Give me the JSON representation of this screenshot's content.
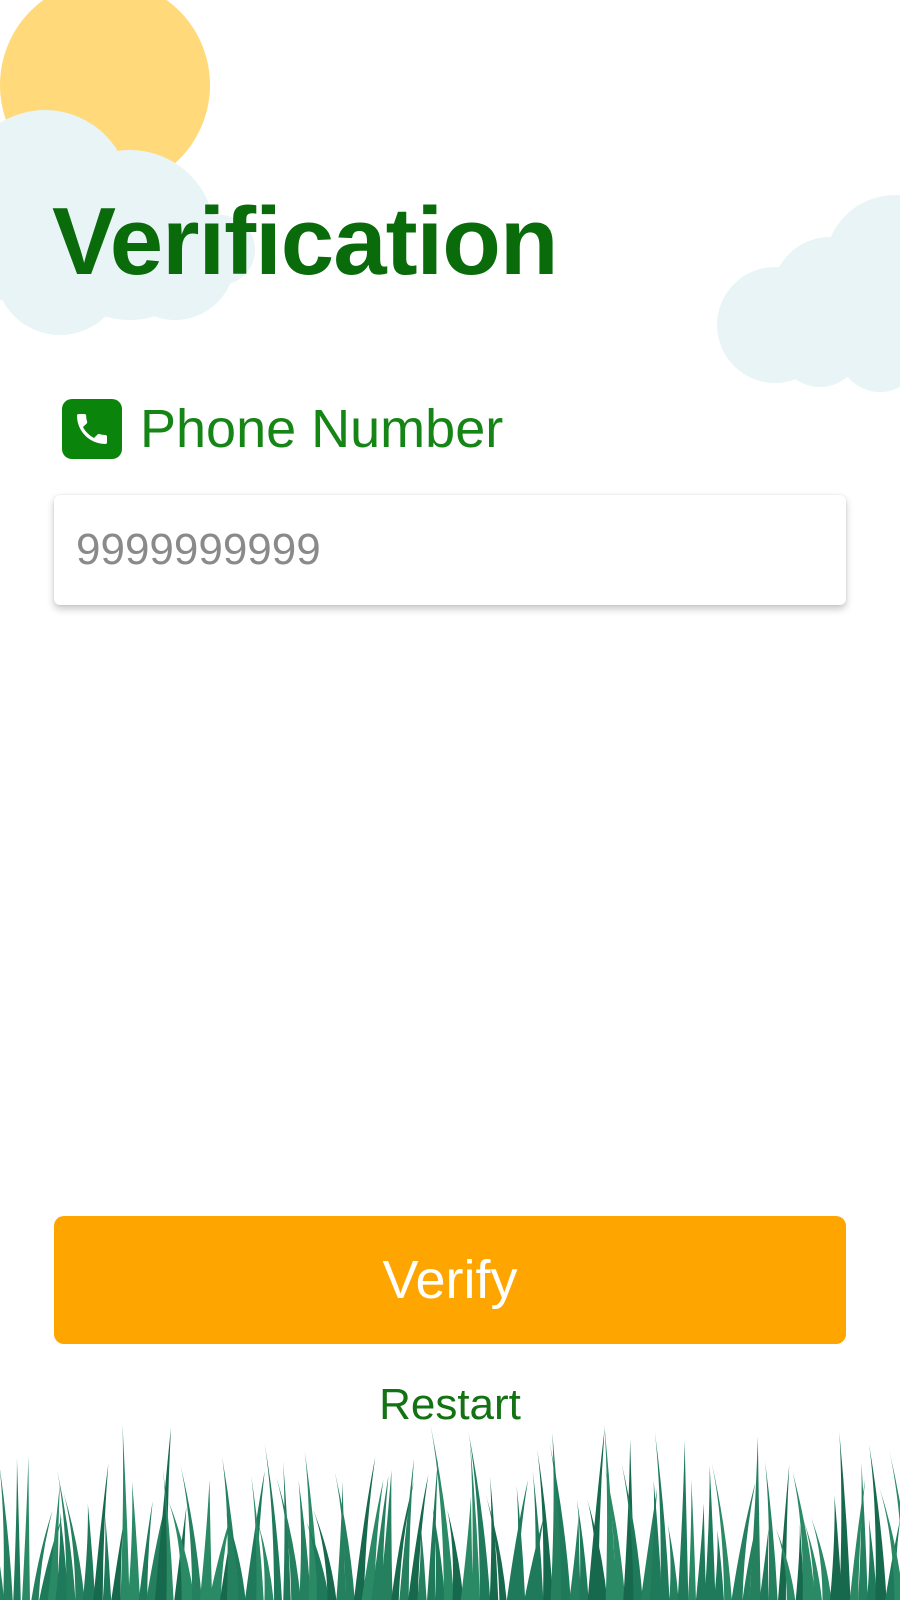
{
  "page": {
    "title": "Verification"
  },
  "phone": {
    "label": "Phone Number",
    "placeholder": "9999999999",
    "value": "",
    "icon": "phone-icon"
  },
  "actions": {
    "verify_label": "Verify",
    "restart_label": "Restart"
  },
  "decor": {
    "sun": "sun-illustration",
    "clouds": "cloud-illustration",
    "grass": "grass-illustration"
  },
  "colors": {
    "primary_green": "#0a6b0a",
    "icon_green": "#0a840a",
    "label_green": "#158515",
    "verify_orange": "#ffa500",
    "sun_yellow": "#ffd97a",
    "cloud_blue": "#e8f4f6",
    "grass_green": "#1e7a5a"
  }
}
